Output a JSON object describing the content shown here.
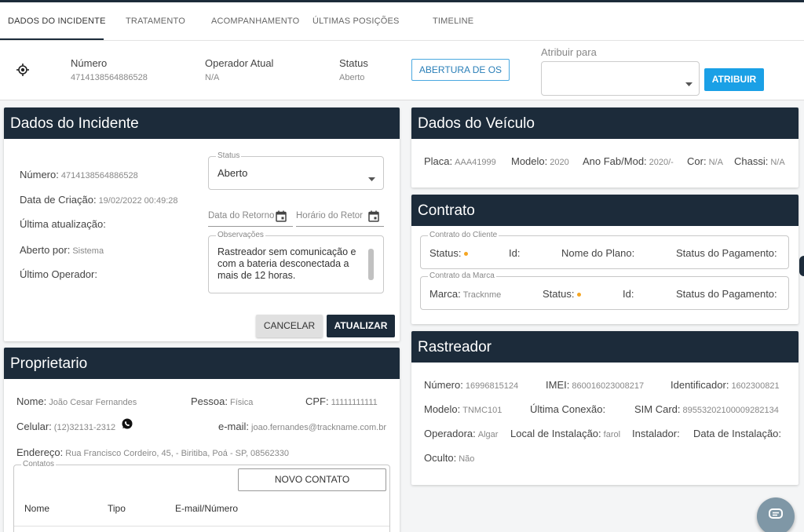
{
  "tabs": [
    {
      "label": "DADOS DO INCIDENTE"
    },
    {
      "label": "TRATAMENTO"
    },
    {
      "label": "ACOMPANHAMENTO"
    },
    {
      "label": "ÚLTIMAS POSIÇÕES"
    },
    {
      "label": "TIMELINE"
    }
  ],
  "infobar": {
    "numero_label": "Número",
    "numero_value": "4714138564886528",
    "operador_label": "Operador Atual",
    "operador_value": "N/A",
    "status_label": "Status",
    "status_value": "Aberto",
    "abertura_button": "ABERTURA DE OS",
    "atribuir_label": "Atribuir para",
    "atribuir_value": "",
    "atribuir_button": "ATRIBUIR"
  },
  "incidente": {
    "title": "Dados do Incidente",
    "numero_label": "Número:",
    "numero_value": "4714138564886528",
    "data_criacao_label": "Data de Criação:",
    "data_criacao_value": "19/02/2022 00:49:28",
    "ultima_atualizacao_label": "Última atualização:",
    "aberto_por_label": "Aberto por:",
    "aberto_por_value": "Sistema",
    "ultimo_operador_label": "Último Operador:",
    "status_legend": "Status",
    "status_value": "Aberto",
    "data_retorno_placeholder": "Data do Retorno",
    "horario_retorno_placeholder": "Horário do Retor",
    "observacoes_legend": "Observações",
    "observacoes_value": "Rastreador sem comunicação e com a bateria desconectada a mais de 12 horas.",
    "cancelar_button": "CANCELAR",
    "atualizar_button": "ATUALIZAR"
  },
  "proprietario": {
    "title": "Proprietario",
    "nome_label": "Nome:",
    "nome_value": "João Cesar Fernandes",
    "pessoa_label": "Pessoa:",
    "pessoa_value": "Física",
    "cpf_label": "CPF:",
    "cpf_value": "11111111111",
    "celular_label": "Celular:",
    "celular_value": "(12)32131-2312",
    "email_label": "e-mail:",
    "email_value": "joao.fernandes@trackname.com.br",
    "endereco_label": "Endereço:",
    "endereco_value": "Rua Francisco Cordeiro, 45, - Biritiba, Poá - SP, 08562330",
    "contatos_legend": "Contatos",
    "novo_contato_button": "NOVO CONTATO",
    "columns": [
      "Nome",
      "Tipo",
      "E-mail/Número"
    ]
  },
  "veiculo": {
    "title": "Dados do Veículo",
    "placa_label": "Placa:",
    "placa_value": "AAA41999",
    "modelo_label": "Modelo:",
    "modelo_value": "2020",
    "ano_label": "Ano Fab/Mod:",
    "ano_value": "2020/-",
    "cor_label": "Cor:",
    "cor_value": "N/A",
    "chassi_label": "Chassi:",
    "chassi_value": "N/A"
  },
  "contrato": {
    "title": "Contrato",
    "cliente_legend": "Contrato do Cliente",
    "cliente_status_label": "Status:",
    "cliente_id_label": "Id:",
    "cliente_plano_label": "Nome do Plano:",
    "cliente_pagamento_label": "Status do Pagamento:",
    "marca_legend": "Contrato da Marca",
    "marca_label": "Marca:",
    "marca_value": "Tracknme",
    "marca_status_label": "Status:",
    "marca_id_label": "Id:",
    "marca_pagamento_label": "Status do Pagamento:"
  },
  "rastreador": {
    "title": "Rastreador",
    "numero_label": "Número:",
    "numero_value": "16996815124",
    "imei_label": "IMEI:",
    "imei_value": "860016023008217",
    "identificador_label": "Identificador:",
    "identificador_value": "1602300821",
    "modelo_label": "Modelo:",
    "modelo_value": "TNMC101",
    "ultima_conexao_label": "Última Conexão:",
    "simcard_label": "SIM Card:",
    "simcard_value": "89553202100009282134",
    "operadora_label": "Operadora:",
    "operadora_value": "Algar",
    "local_label": "Local de Instalação:",
    "local_value": "farol",
    "instalador_label": "Instalador:",
    "data_instalacao_label": "Data de Instalação:",
    "oculto_label": "Oculto:",
    "oculto_value": "Não"
  },
  "colors": {
    "header_bg": "#1c2b3a",
    "accent_blue": "#1aa0e6",
    "status_dot": "#f5a623"
  },
  "icons": [
    "crosshair-icon",
    "chevron-down-icon",
    "calendar-icon",
    "whatsapp-icon",
    "chat-icon"
  ]
}
